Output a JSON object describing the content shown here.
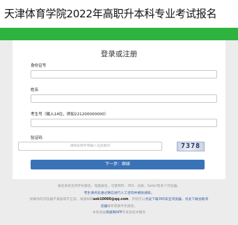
{
  "header": {
    "title": "天津体育学院2022年高职升本科专业考试报名",
    "accent_color": "#2db33e"
  },
  "form": {
    "title": "登录或注册",
    "id_label": "身份证号",
    "name_label": "姓名",
    "exam_no_label": "考生号（输入14位，例如221200000000）",
    "captcha_label": "验证码",
    "captcha_placeholder": "请将右侧字母输入在此框内",
    "captcha_value": "7378",
    "next_button": "下一步：继续"
  },
  "footer": {
    "line1": "报名系统支持手机报名、电脑报名，可使用IE、360、谷歌、Safari等多个浏览器。",
    "line2": "考生请点此通过微信进行人工咨询并被收通知。",
    "line3_pre": "如果你的浏览器不兼容或不正常，请通知邮",
    "line3_email": "ask10060@qq.com",
    "line3_mid": "，开始可以",
    "line3_link": "点此下载360安全浏览器",
    "line3_post": "，点此下载谷歌浏",
    "line4": "览器",
    "line4_post": "解析或换手机报名。",
    "line5_pre": "本系统由",
    "line5_link": "高报网APP",
    "line5_post": "开发及技术服务"
  }
}
